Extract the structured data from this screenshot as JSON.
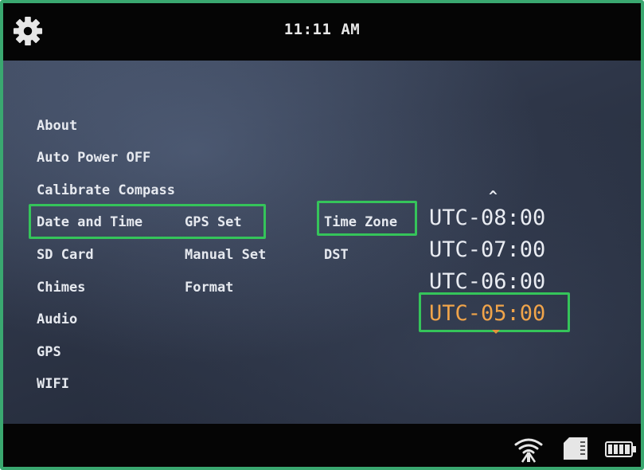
{
  "header": {
    "settings_icon": "gear-icon",
    "time": "11:11 AM"
  },
  "menu": {
    "column1": [
      "About",
      "Auto Power OFF",
      "Calibrate Compass",
      "Date and Time",
      "SD Card",
      "Chimes",
      "Audio",
      "GPS",
      "WIFI"
    ],
    "column2": [
      "GPS Set",
      "Manual Set",
      "Format"
    ],
    "column3": [
      "Time Zone",
      "DST"
    ],
    "timezones": [
      "UTC-08:00",
      "UTC-07:00",
      "UTC-06:00",
      "UTC-05:00"
    ],
    "selected_timezone": "UTC-05:00"
  },
  "status_bar": {
    "icons": [
      "wifi-icon",
      "sd-card-icon",
      "battery-icon"
    ]
  },
  "colors": {
    "highlight": "#35c45a",
    "selected_text": "#f0a44a",
    "frame": "#3aa870"
  }
}
